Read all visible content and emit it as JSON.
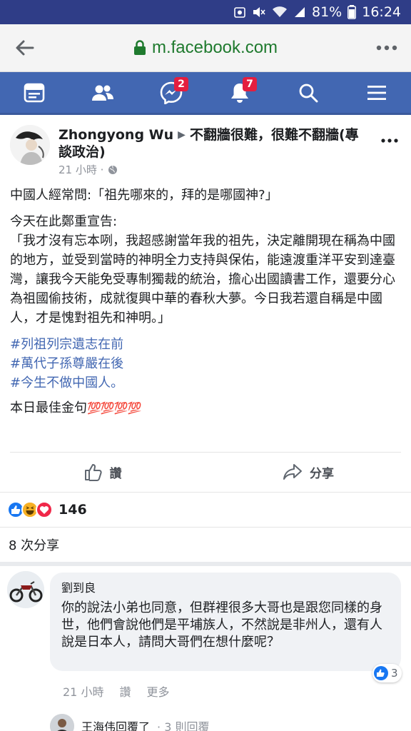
{
  "status_bar": {
    "battery": "81%",
    "time": "16:24"
  },
  "browser": {
    "url": "m.facebook.com"
  },
  "fb_nav": {
    "messages_badge": "2",
    "notifications_badge": "7"
  },
  "post": {
    "author": "Zhongyong Wu",
    "group": "不翻牆很難，很難不翻牆(專談政治)",
    "time": "21 小時 ·",
    "line1": "中國人經常問:「祖先哪來的，拜的是哪國神?」",
    "line2": "今天在此鄭重宣告:",
    "quote": "「我才沒有忘本咧，我超感謝當年我的祖先，決定離開現在稱為中國的地方，並受到當時的神明全力支持與保佑，能遠渡重洋平安到達臺灣，讓我今天能免受專制獨裁的統治，擔心出國讀書工作，還要分心為祖國偷技術，成就復興中華的春秋大夢。今日我若還自稱是中國人，才是愧對祖先和神明。」",
    "hashtags": [
      "#列祖列宗遺志在前",
      "#萬代子孫尊嚴在後",
      "#今生不做中國人。"
    ],
    "closing": "本日最佳金句",
    "closing_emoji": "💯💯💯💯"
  },
  "actions": {
    "like_label": "讚",
    "share_label": "分享"
  },
  "reactions": {
    "count": "146"
  },
  "shares": "8 次分享",
  "comment": {
    "author": "劉到良",
    "text": "你的說法小弟也同意，但群裡很多大哥也是跟您同樣的身世，他們會說他們是平埔族人，不然說是非州人，還有人說是日本人，請問大哥們在想什麼呢？",
    "likes": "3",
    "time": "21 小時",
    "like_action": "讚",
    "more_action": "更多"
  },
  "reply": {
    "text": "王海伟回覆了",
    "count": "· 3 則回覆"
  },
  "colors": {
    "fb_blue": "#4267b2",
    "status_bar": "#2f3d87",
    "badge_red": "#e41e3f",
    "url_green": "#1f7a2e"
  }
}
